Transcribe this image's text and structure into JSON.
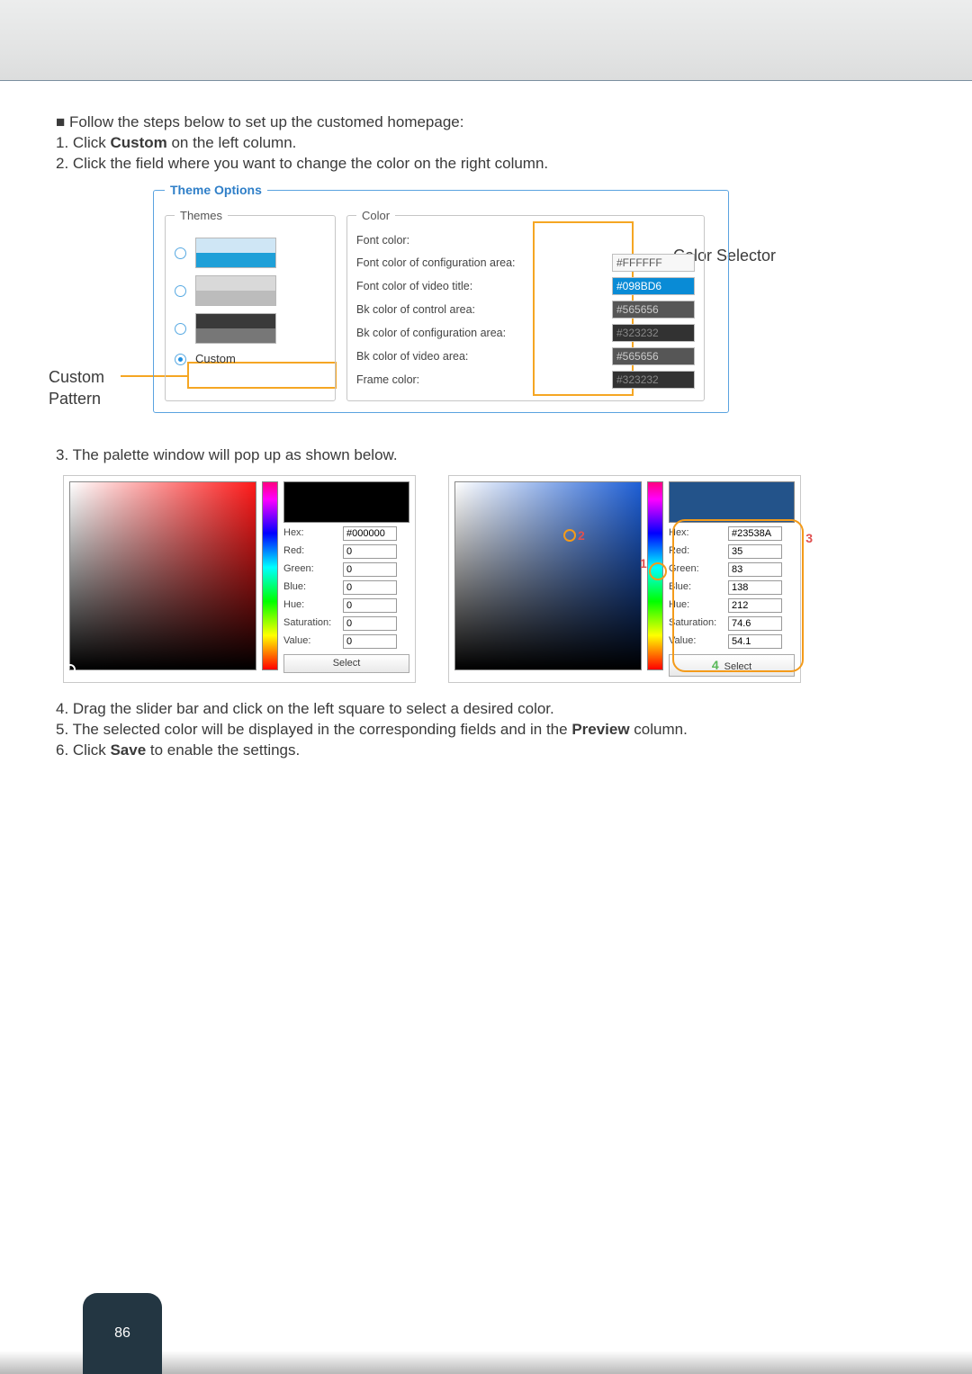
{
  "intro": {
    "bullet": "■ Follow the steps below to set up the customed homepage:",
    "s1_pre": "1. Click ",
    "s1_b": "Custom",
    "s1_post": " on the left column.",
    "s2": "2. Click the field where you want to change the color on the right column."
  },
  "fig1": {
    "outer_legend": "Theme Options",
    "themes_legend": "Themes",
    "custom_label": "Custom",
    "colors_legend": "Color",
    "rows": [
      {
        "label": "Font color:",
        "value": "",
        "cls": ""
      },
      {
        "label": "Font color of configuration area:",
        "value": "#FFFFFF",
        "cls": ""
      },
      {
        "label": "Font color of video title:",
        "value": "#098BD6",
        "cls": "hl"
      },
      {
        "label": "Bk color of control area:",
        "value": "#565656",
        "cls": "dark"
      },
      {
        "label": "Bk color of configuration area:",
        "value": "#323232",
        "cls": "vdk"
      },
      {
        "label": "Bk color of video area:",
        "value": "#565656",
        "cls": "dark"
      },
      {
        "label": "Frame color:",
        "value": "#323232",
        "cls": "vdk"
      }
    ],
    "label_left": "Custom Pattern",
    "label_right": "Color Selector"
  },
  "step3": "3. The palette window will pop up as shown below.",
  "pal_labels": {
    "hex": "Hex:",
    "red": "Red:",
    "green": "Green:",
    "blue": "Blue:",
    "hue": "Hue:",
    "sat": "Saturation:",
    "val": "Value:",
    "select": "Select"
  },
  "pal1": {
    "hex": "#000000",
    "r": "0",
    "g": "0",
    "b": "0",
    "h": "0",
    "s": "0",
    "v": "0",
    "sw": "#000000"
  },
  "pal2": {
    "hex": "#23538A",
    "r": "35",
    "g": "83",
    "b": "138",
    "h": "212",
    "s": "74.6",
    "v": "54.1",
    "sw": "#23538A"
  },
  "marks": {
    "n1": "1",
    "n2": "2",
    "n3": "3",
    "n4": "4"
  },
  "steps456": {
    "s4": "4. Drag the slider bar and click on the left square to select a desired color.",
    "s5_pre": "5. The selected color will be displayed in the corresponding fields and in the ",
    "s5_b": "Preview",
    "s5_post": " column.",
    "s6_pre": "6. Click ",
    "s6_b": "Save",
    "s6_post": " to enable the settings."
  },
  "page_number": "86"
}
